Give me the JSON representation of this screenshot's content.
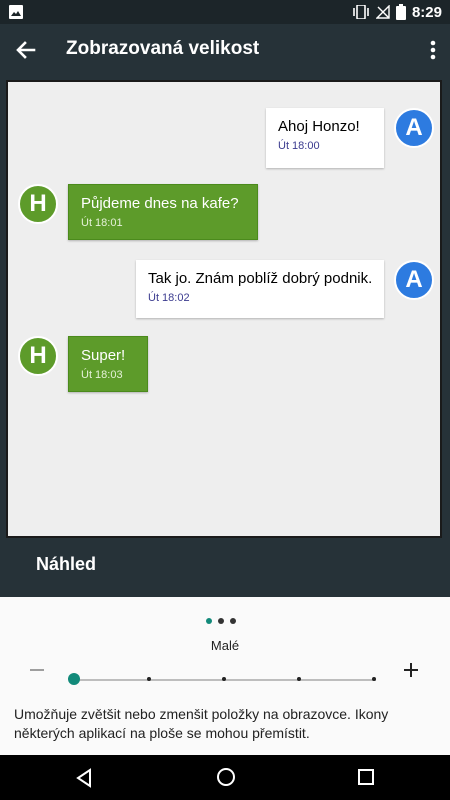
{
  "status_bar": {
    "time": "8:29",
    "icons": [
      "image-notification-icon",
      "vibrate-icon",
      "no-signal-icon",
      "battery-icon"
    ]
  },
  "app_bar": {
    "title": "Zobrazovaná velikost",
    "back_icon": "arrow-left-icon",
    "menu_icon": "more-vert-icon"
  },
  "preview": {
    "messages": [
      {
        "sender": "A",
        "text": "Ahoj Honzo!",
        "time": "Út 18:00"
      },
      {
        "sender": "H",
        "text": "Půjdeme dnes na kafe?",
        "time": "Út 18:01"
      },
      {
        "sender": "A",
        "text": "Tak jo. Znám poblíž dobrý podnik.",
        "time": "Út 18:02"
      },
      {
        "sender": "H",
        "text": "Super!",
        "time": "Út 18:03"
      }
    ],
    "label": "Náhled"
  },
  "size_control": {
    "current_label": "Malé",
    "page_dots": 3,
    "active_dot": 1,
    "steps": 5,
    "selected_step": 1,
    "description": "Umožňuje zvětšit nebo zmenšit položky na obrazovce. Ikony některých aplikací na ploše se mohou přemístit."
  },
  "colors": {
    "accent": "#128a7a",
    "bubble_green": "#5d9b2a",
    "avatar_blue": "#2d7be0",
    "app_bar": "#263238"
  }
}
